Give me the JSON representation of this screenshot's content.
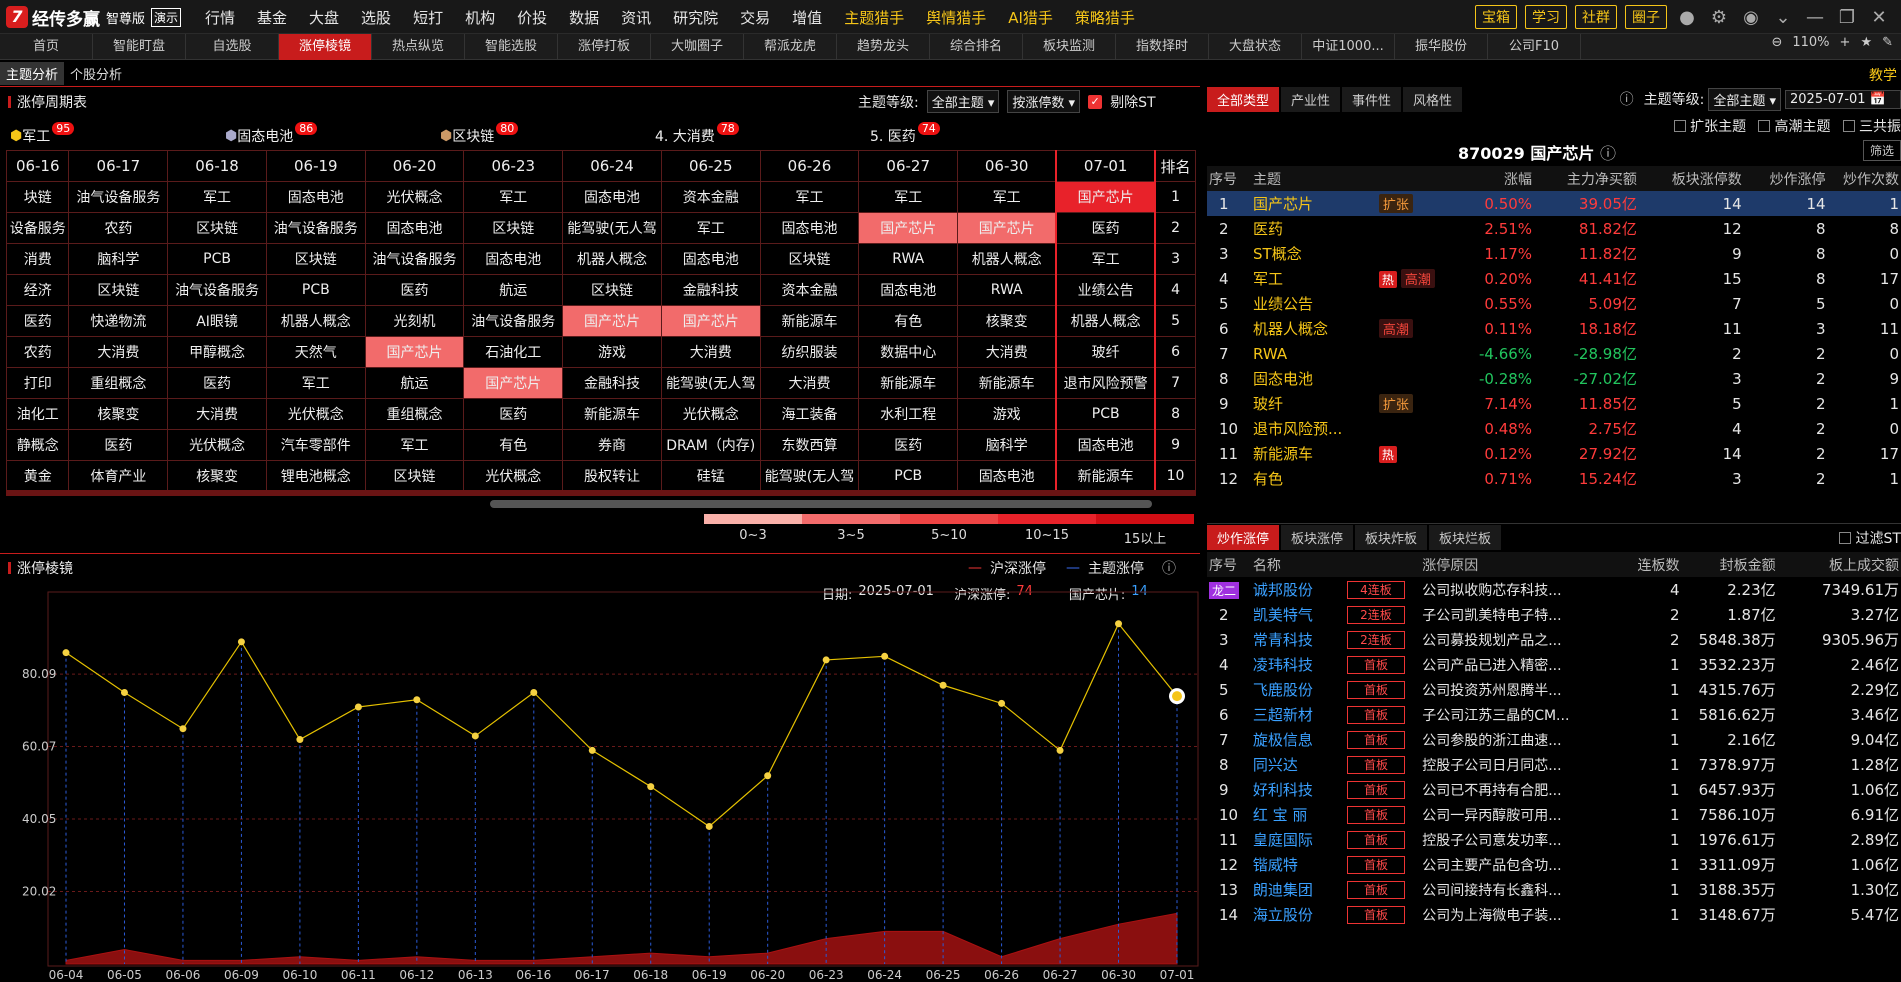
{
  "app": {
    "brand": "经传多赢",
    "edition": "智尊版",
    "demo": "演示"
  },
  "topmenu": [
    "行情",
    "基金",
    "大盘",
    "选股",
    "短打",
    "机构",
    "价投",
    "数据",
    "资讯",
    "研究院",
    "交易",
    "增值",
    "主题猎手",
    "舆情猎手",
    "AI猎手",
    "策略猎手"
  ],
  "topbtns": [
    "宝箱",
    "学习",
    "社群",
    "圈子"
  ],
  "tabs": [
    "首页",
    "智能盯盘",
    "自选股",
    "涨停棱镜",
    "热点纵览",
    "智能选股",
    "涨停打板",
    "大咖圈子",
    "帮派龙虎",
    "趋势龙头",
    "综合排名",
    "板块监测",
    "指数择时",
    "大盘状态",
    "中证1000...",
    "振华股份",
    "公司F10"
  ],
  "tabs_active": 3,
  "zoom": "110%",
  "subtabs": [
    "主题分析",
    "个股分析"
  ],
  "tutorial": "教学",
  "cycle": {
    "title": "涨停周期表",
    "level_label": "主题等级:",
    "level_value": "全部主题",
    "sort_value": "按涨停数",
    "exclude_st": "剔除ST",
    "hot": [
      {
        "label": "军工",
        "count": "95",
        "icon": "diamond-icon"
      },
      {
        "label": "固态电池",
        "count": "86",
        "icon": "cube-icon"
      },
      {
        "label": "区块链",
        "count": "80",
        "icon": "cube-icon"
      },
      {
        "label": "4. 大消费",
        "count": "78"
      },
      {
        "label": "5. 医药",
        "count": "74"
      }
    ],
    "dates": [
      "06-16",
      "06-17",
      "06-18",
      "06-19",
      "06-20",
      "06-23",
      "06-24",
      "06-25",
      "06-26",
      "06-27",
      "06-30",
      "07-01"
    ],
    "rank_label": "排名",
    "rows": [
      [
        "块链",
        "油气设备服务",
        "军工",
        "固态电池",
        "光伏概念",
        "军工",
        "固态电池",
        "资本金融",
        "军工",
        "军工",
        "军工",
        "国产芯片"
      ],
      [
        "设备服务",
        "农药",
        "区块链",
        "油气设备服务",
        "固态电池",
        "区块链",
        "能驾驶(无人驾",
        "军工",
        "固态电池",
        "国产芯片",
        "国产芯片",
        "医药"
      ],
      [
        "消费",
        "脑科学",
        "PCB",
        "区块链",
        "油气设备服务",
        "固态电池",
        "机器人概念",
        "固态电池",
        "区块链",
        "RWA",
        "机器人概念",
        "军工"
      ],
      [
        "经济",
        "区块链",
        "油气设备服务",
        "PCB",
        "医药",
        "航运",
        "区块链",
        "金融科技",
        "资本金融",
        "固态电池",
        "RWA",
        "业绩公告"
      ],
      [
        "医药",
        "快递物流",
        "AI眼镜",
        "机器人概念",
        "光刻机",
        "油气设备服务",
        "国产芯片",
        "国产芯片",
        "新能源车",
        "有色",
        "核聚变",
        "机器人概念"
      ],
      [
        "农药",
        "大消费",
        "甲醇概念",
        "天然气",
        "国产芯片",
        "石油化工",
        "游戏",
        "大消费",
        "纺织服装",
        "数据中心",
        "大消费",
        "玻纤"
      ],
      [
        "打印",
        "重组概念",
        "医药",
        "军工",
        "航运",
        "国产芯片",
        "金融科技",
        "能驾驶(无人驾",
        "大消费",
        "新能源车",
        "新能源车",
        "退市风险预警"
      ],
      [
        "油化工",
        "核聚变",
        "大消费",
        "光伏概念",
        "重组概念",
        "医药",
        "新能源车",
        "光伏概念",
        "海工装备",
        "水利工程",
        "游戏",
        "PCB"
      ],
      [
        "静概念",
        "医药",
        "光伏概念",
        "汽车零部件",
        "军工",
        "有色",
        "券商",
        "DRAM（内存)",
        "东数西算",
        "医药",
        "脑科学",
        "固态电池"
      ],
      [
        "黄金",
        "体育产业",
        "核聚变",
        "锂电池概念",
        "区块链",
        "光伏概念",
        "股权转让",
        "硅锰",
        "能驾驶(无人驾",
        "PCB",
        "固态电池",
        "新能源车"
      ]
    ],
    "legend": [
      "0~3",
      "3~5",
      "5~10",
      "10~15",
      "15以上"
    ]
  },
  "chart": {
    "title": "涨停棱镜",
    "legend": [
      "沪深涨停",
      "主题涨停"
    ],
    "date_label": "日期:",
    "date": "2025-07-01",
    "hs_label": "沪深涨停:",
    "hs_value": "74",
    "theme_label": "国产芯片:",
    "theme_value": "14"
  },
  "chart_data": {
    "type": "line",
    "x": [
      "06-04",
      "06-05",
      "06-06",
      "06-09",
      "06-10",
      "06-11",
      "06-12",
      "06-13",
      "06-16",
      "06-17",
      "06-18",
      "06-19",
      "06-20",
      "06-23",
      "06-24",
      "06-25",
      "06-26",
      "06-27",
      "06-30",
      "07-01"
    ],
    "y_ticks": [
      "80.09",
      "60.07",
      "40.05",
      "20.02"
    ],
    "ylim": [
      0,
      100
    ],
    "series": [
      {
        "name": "沪深涨停",
        "values": [
          86,
          75,
          65,
          89,
          62,
          71,
          73,
          63,
          75,
          59,
          49,
          38,
          52,
          84,
          85,
          77,
          72,
          59,
          94,
          74
        ]
      },
      {
        "name": "主题涨停",
        "values": [
          1,
          4,
          1,
          1,
          2,
          1,
          2,
          1,
          1,
          2,
          3,
          2,
          3,
          7,
          9,
          9,
          2,
          7,
          11,
          14
        ]
      }
    ]
  },
  "right": {
    "tabs": [
      "全部类型",
      "产业性",
      "事件性",
      "风格性"
    ],
    "level_label": "主题等级:",
    "level_value": "全部主题",
    "date": "2025-07-01",
    "checks": [
      "扩张主题",
      "高潮主题",
      "三共振"
    ],
    "filter": "筛选",
    "headline": "870029 国产芯片",
    "cols": [
      "序号",
      "主题",
      "涨幅",
      "主力净买额",
      "板块涨停数",
      "炒作涨停",
      "炒作次数"
    ],
    "rows": [
      [
        "1",
        "国产芯片",
        "扩张",
        "0.50%",
        "39.05亿",
        "14",
        "14",
        "1"
      ],
      [
        "2",
        "医药",
        "",
        "2.51%",
        "81.82亿",
        "12",
        "8",
        "8"
      ],
      [
        "3",
        "ST概念",
        "",
        "1.17%",
        "11.82亿",
        "9",
        "8",
        "0"
      ],
      [
        "4",
        "军工",
        "热 高潮",
        "0.20%",
        "41.41亿",
        "15",
        "8",
        "17"
      ],
      [
        "5",
        "业绩公告",
        "",
        "0.55%",
        "5.09亿",
        "7",
        "5",
        "0"
      ],
      [
        "6",
        "机器人概念",
        "高潮",
        "0.11%",
        "18.18亿",
        "11",
        "3",
        "11"
      ],
      [
        "7",
        "RWA",
        "",
        "-4.66%",
        "-28.98亿",
        "2",
        "2",
        "0"
      ],
      [
        "8",
        "固态电池",
        "",
        "-0.28%",
        "-27.02亿",
        "3",
        "2",
        "9"
      ],
      [
        "9",
        "玻纤",
        "扩张",
        "7.14%",
        "11.85亿",
        "5",
        "2",
        "1"
      ],
      [
        "10",
        "退市风险预...",
        "",
        "0.48%",
        "2.75亿",
        "4",
        "2",
        "0"
      ],
      [
        "11",
        "新能源车",
        "热",
        "0.12%",
        "27.92亿",
        "14",
        "2",
        "17"
      ],
      [
        "12",
        "有色",
        "",
        "0.71%",
        "15.24亿",
        "3",
        "2",
        "1"
      ]
    ],
    "tabs2": [
      "炒作涨停",
      "板块涨停",
      "板块炸板",
      "板块烂板"
    ],
    "filter_st": "过滤ST",
    "cols2": [
      "序号",
      "名称",
      "涨停原因",
      "连板数",
      "封板金额",
      "板上成交额"
    ],
    "stocks": [
      [
        "1",
        "诚邦股份",
        "4连板",
        "公司拟收购芯存科技...",
        "4",
        "2.23亿",
        "7349.61万",
        "龙二"
      ],
      [
        "2",
        "凯美特气",
        "2连板",
        "子公司凯美特电子特...",
        "2",
        "1.87亿",
        "3.27亿",
        ""
      ],
      [
        "3",
        "常青科技",
        "2连板",
        "公司募投规划产品之...",
        "2",
        "5848.38万",
        "9305.96万",
        ""
      ],
      [
        "4",
        "凌玮科技",
        "首板",
        "公司产品已进入精密...",
        "1",
        "3532.23万",
        "2.46亿",
        ""
      ],
      [
        "5",
        "飞鹿股份",
        "首板",
        "公司投资苏州恩腾半...",
        "1",
        "4315.76万",
        "2.29亿",
        ""
      ],
      [
        "6",
        "三超新材",
        "首板",
        "子公司江苏三晶的CM...",
        "1",
        "5816.62万",
        "3.46亿",
        ""
      ],
      [
        "7",
        "旋极信息",
        "首板",
        "公司参股的浙江曲速...",
        "1",
        "2.16亿",
        "9.04亿",
        ""
      ],
      [
        "8",
        "同兴达",
        "首板",
        "控股子公司日月同芯...",
        "1",
        "7378.97万",
        "1.28亿",
        ""
      ],
      [
        "9",
        "好利科技",
        "首板",
        "公司已不再持有合肥...",
        "1",
        "6457.93万",
        "1.06亿",
        ""
      ],
      [
        "10",
        "红 宝 丽",
        "首板",
        "公司一异丙醇胺可用...",
        "1",
        "7586.10万",
        "6.91亿",
        ""
      ],
      [
        "11",
        "皇庭国际",
        "首板",
        "控股子公司意发功率...",
        "1",
        "1976.61万",
        "2.89亿",
        ""
      ],
      [
        "12",
        "锴威特",
        "首板",
        "公司主要产品包含功...",
        "1",
        "3311.09万",
        "1.06亿",
        ""
      ],
      [
        "13",
        "朗迪集团",
        "首板",
        "公司间接持有长鑫科...",
        "1",
        "3188.35万",
        "1.30亿",
        ""
      ],
      [
        "14",
        "海立股份",
        "首板",
        "公司为上海微电子装...",
        "1",
        "3148.67万",
        "5.47亿",
        ""
      ]
    ]
  }
}
